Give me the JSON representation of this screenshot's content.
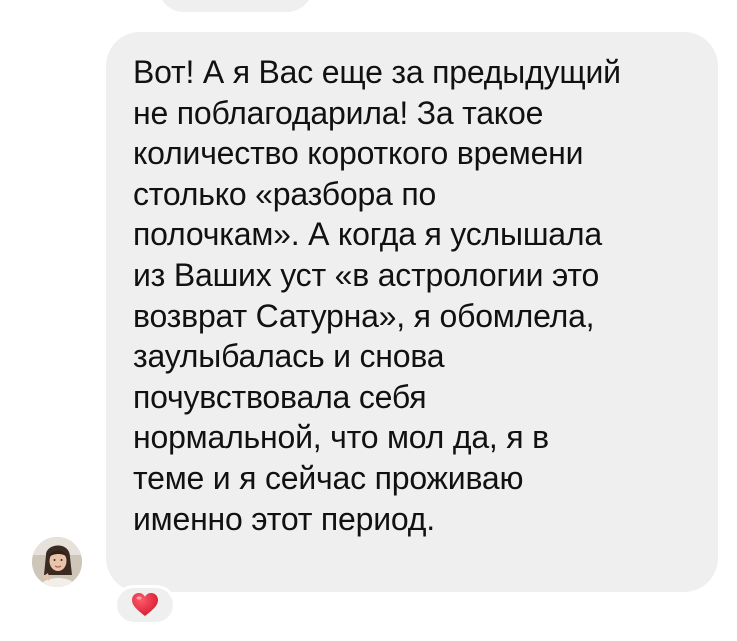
{
  "message": {
    "lines": [
      "Вот! А я Вас еще за предыдущий",
      "не поблагодарила! За такое",
      "количество короткого времени",
      "столько «разбора по",
      "полочкам». А когда я услышала",
      "из Ваших уст «в астрологии это",
      "возврат Сатурна», я обомлела,",
      "заулыбалась и снова",
      "почувствовала себя",
      "нормальной, что мол да, я в",
      "теме и я сейчас проживаю",
      "именно этот период."
    ],
    "reaction_icon": "red-heart-icon",
    "avatar_icon": "user-avatar"
  },
  "colors": {
    "bubble": "#efefef",
    "text": "#111111",
    "heart": "#e0263a",
    "background": "#ffffff"
  }
}
